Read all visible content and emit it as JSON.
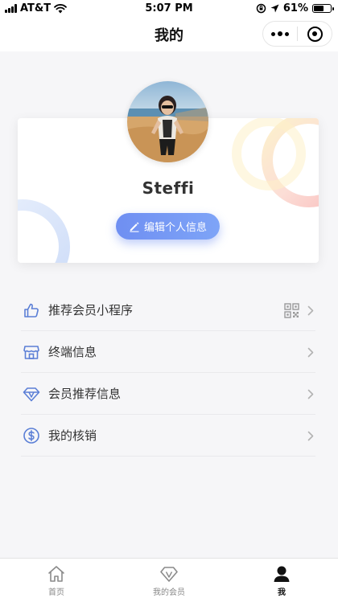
{
  "status_bar": {
    "carrier": "AT&T",
    "time": "5:07 PM",
    "battery_percent": "61%",
    "battery_level": 0.61
  },
  "nav": {
    "title": "我的"
  },
  "profile": {
    "name": "Steffi",
    "edit_label": "编辑个人信息"
  },
  "menu": {
    "items": [
      {
        "label": "推荐会员小程序",
        "icon": "thumbs-up-icon"
      },
      {
        "label": "终端信息",
        "icon": "store-icon"
      },
      {
        "label": "会员推荐信息",
        "icon": "diamond-icon"
      },
      {
        "label": "我的核销",
        "icon": "dollar-circle-icon"
      }
    ]
  },
  "tabs": [
    {
      "label": "首页",
      "icon": "home-icon",
      "active": false
    },
    {
      "label": "我的会员",
      "icon": "diamond-icon",
      "active": false
    },
    {
      "label": "我",
      "icon": "user-icon",
      "active": true
    }
  ],
  "colors": {
    "accent": "#6f8ff2",
    "icon_blue": "#5b7fd6",
    "background": "#f6f6f8"
  }
}
